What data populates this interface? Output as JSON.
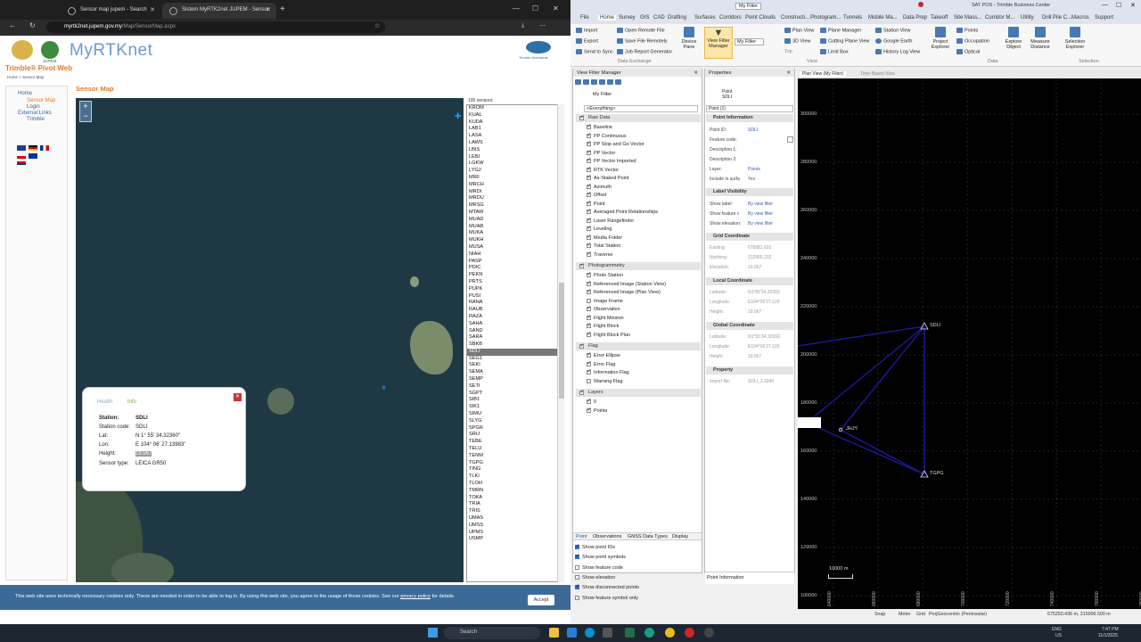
{
  "browser": {
    "tabs": [
      {
        "title": "Sensor map jupem - Search"
      },
      {
        "title": "Sistem MyRTK2net JUPEM - Sensor"
      }
    ],
    "url_host": "myrtk2net.jupem.gov.my",
    "url_path": "/Map/SensorMap.aspx"
  },
  "site": {
    "brand": "MyRTKnet",
    "brand_sub": "JUPEM",
    "subtitle": "Trimble® Pivot Web",
    "corner_logo_text": "Trimble Worldwide",
    "breadcrumb": "Home > Sensor Map",
    "nav": [
      "Home",
      "Sensor Map",
      "Login",
      "External Links",
      "Trimble"
    ],
    "page_title": "Sensor Map",
    "sensor_count": "100 sensors:",
    "sensors": [
      "KROM",
      "KUAL",
      "KUDA",
      "LAB1",
      "LASA",
      "LAWS",
      "LBIS",
      "LEBI",
      "LGKW",
      "LYG2",
      "MIRI",
      "MRCH",
      "MRDI",
      "MRDU",
      "MRSG",
      "MTAW",
      "MUAD",
      "MUAR",
      "MUKA",
      "MUKH",
      "MUSA",
      "NIAH",
      "PASP",
      "PDIC",
      "PEKN",
      "PRTS",
      "PUPK",
      "PUSI",
      "RANA",
      "RAUB",
      "RAZA",
      "SAHA",
      "SAND",
      "SARA",
      "SBKB",
      "SDLI",
      "SEG1",
      "SEKI",
      "SEMA",
      "SEMP",
      "SETI",
      "SGPT",
      "SIB1",
      "SIK1",
      "SIMU",
      "SLYG",
      "SPGR",
      "SRIJ",
      "TEBE",
      "TELU",
      "TENM",
      "TGPG",
      "TING",
      "TLKI",
      "TLOH",
      "TMRN",
      "TOKA",
      "TRIA",
      "TRIS",
      "UMAS",
      "UMSS",
      "UPMS",
      "USMP"
    ],
    "selected_sensor": "SDLI",
    "popup": {
      "tab_health": "Health",
      "tab_info": "Info",
      "rows": [
        {
          "label": "Station:",
          "value": "SDLI"
        },
        {
          "label": "Station code:",
          "value": "SDLI"
        },
        {
          "label": "Lat:",
          "value": "N 1° 55' 34.32360\""
        },
        {
          "label": "Lon:",
          "value": "E 104° 06' 27.13983\""
        },
        {
          "label": "Height:",
          "value": "19.567"
        },
        {
          "label": "Sensor type:",
          "value": "LEICA GR50"
        }
      ]
    },
    "cookie_text": "This web site uses technically necessary cookies only. These are needed in order to be able to log in. By using this web site, you agree to the usage of those cookies. See our",
    "cookie_link": "privacy policy",
    "cookie_tail": "for details.",
    "accept": "Accept"
  },
  "tbc": {
    "title": "SAT POS - Trimble Business Center",
    "filter_name": "My Filter",
    "menus": [
      "File",
      "Home",
      "Survey",
      "GIS",
      "CAD",
      "Drafting",
      "Surfaces",
      "Corridors",
      "Point Clouds",
      "Constructi...",
      "Photogram...",
      "Tunnels",
      "Mobile Ma...",
      "Data Prep",
      "Takeoff",
      "Site Mass...",
      "Corridor M...",
      "Utility",
      "Drill Pile C...",
      "Macros",
      "Support"
    ],
    "ribbon": {
      "import": "Import",
      "export": "Export",
      "send_to_sync": "Send to Sync",
      "open_remote": "Open Remote File",
      "save_remote": "Save File Remotely",
      "job_report": "Job Report Generator",
      "group_data_exchange": "Data Exchange",
      "device_pane": "Device Pane",
      "view_filter_manager": "View Filter Manager",
      "my_filter": "My Filter",
      "plan_view": "Plan View",
      "view_3d": "3D View",
      "top": "Top",
      "plane_manager": "Plane Manager",
      "cutting_plane_view": "Cutting Plane View",
      "limit_box": "Limit Box",
      "station_view": "Station View",
      "google_earth": "Google Earth",
      "history_log_view": "History Log View",
      "group_view": "View",
      "project_explorer": "Project Explorer",
      "points": "Points",
      "occupation": "Occupation",
      "optical": "Optical",
      "explore_object": "Explore Object",
      "measure_distance": "Measure Distance",
      "group_data": "Data",
      "selection_explorer": "Selection Explorer",
      "group_selection": "Selection"
    },
    "vfm": {
      "title": "View Filter Manager",
      "filter": "My Filter",
      "everything": "<Everything>",
      "groups": [
        {
          "name": "Raw Data",
          "items": [
            {
              "label": "Baseline",
              "on": true
            },
            {
              "label": "PP Continuous",
              "on": true
            },
            {
              "label": "PP Stop and Go Vector",
              "on": true
            },
            {
              "label": "PP Vector",
              "on": true
            },
            {
              "label": "PP Vector Imported",
              "on": true
            },
            {
              "label": "RTK Vector",
              "on": true
            },
            {
              "label": "As-Staked Point",
              "on": true
            },
            {
              "label": "Azimuth",
              "on": true
            },
            {
              "label": "Offset",
              "on": true
            },
            {
              "label": "Point",
              "on": true
            },
            {
              "label": "Averaged Point Relationships",
              "on": true
            },
            {
              "label": "Laser Rangefinder",
              "on": true
            },
            {
              "label": "Leveling",
              "on": true
            },
            {
              "label": "Media Folder",
              "on": true
            },
            {
              "label": "Total Station",
              "on": true
            },
            {
              "label": "Traverse",
              "on": true
            }
          ]
        },
        {
          "name": "Photogrammetry",
          "items": [
            {
              "label": "Photo Station",
              "on": true
            },
            {
              "label": "Referenced Image (Station View)",
              "on": true
            },
            {
              "label": "Referenced Image (Plan View)",
              "on": true
            },
            {
              "label": "Image Frame",
              "on": false
            },
            {
              "label": "Observation",
              "on": true
            },
            {
              "label": "Flight Mission",
              "on": true
            },
            {
              "label": "Flight Block",
              "on": true
            },
            {
              "label": "Flight Block Plan",
              "on": true
            }
          ]
        },
        {
          "name": "Flag",
          "items": [
            {
              "label": "Error Ellipse",
              "on": true
            },
            {
              "label": "Error Flag",
              "on": true
            },
            {
              "label": "Information Flag",
              "on": true
            },
            {
              "label": "Warning Flag",
              "on": false
            }
          ]
        },
        {
          "name": "Layers",
          "items": [
            {
              "label": "0",
              "on": true
            },
            {
              "label": "Points",
              "on": true
            }
          ]
        }
      ],
      "bottom_tabs": [
        "Point",
        "Observations",
        "GNSS Data Types",
        "Display"
      ],
      "options": [
        {
          "label": "Show point IDs",
          "on": true
        },
        {
          "label": "Show point symbols",
          "on": true
        },
        {
          "label": "Show feature code",
          "on": false
        },
        {
          "label": "Show elevation",
          "on": false
        },
        {
          "label": "Show disconnected points",
          "on": true
        },
        {
          "label": "Show feature symbol only",
          "on": false
        }
      ]
    },
    "props": {
      "title": "Properties",
      "header_type": "Point",
      "header_id": "SDLI",
      "point_count": "Point (1)",
      "sections": {
        "point_info": "Point Information",
        "label_vis": "Label Visibility",
        "grid": "Grid Coordinate",
        "local": "Local Coordinate",
        "global": "Global Coordinate",
        "property": "Property"
      },
      "point_id_label": "Point ID:",
      "point_id": "SDLI",
      "feature_code_label": "Feature code:",
      "desc1_label": "Description 1:",
      "desc2_label": "Description 2:",
      "layer_label": "Layer:",
      "layer": "Points",
      "include_label": "Include in surfa",
      "include": "Yes",
      "show_label_label": "Show label:",
      "show_label": "By view filter",
      "show_feature_label": "Show feature c",
      "show_feature": "By view filter",
      "show_elev_label": "Show elevation:",
      "show_elev": "By view filter",
      "easting_label": "Easting:",
      "easting": "679981.601",
      "northing_label": "Northing:",
      "northing": "212965.232",
      "elevation_label": "Elevation:",
      "elevation": "19.567",
      "lat_label": "Latitude:",
      "lat": "N1°55'34.32360",
      "lon_label": "Longitude:",
      "lon": "E104°06'27.139",
      "height_label": "Height:",
      "height": "19.567",
      "glat": "N1°55'34.32360",
      "glon": "E104°06'27.139",
      "gheight": "19.567",
      "import_label": "Import file:",
      "import_file": "SDLI_1.3240",
      "footer": "Point Information"
    },
    "planview": {
      "tab_plan": "Plan View (My Filter)",
      "tab_time": "Time-Based View",
      "y_ticks": [
        "300000",
        "280000",
        "260000",
        "240000",
        "220000",
        "200000",
        "180000",
        "160000",
        "140000",
        "120000",
        "100000"
      ],
      "x_ticks": [
        "640000",
        "660000",
        "680000",
        "700000",
        "720000",
        "740000",
        "760000",
        "780000"
      ],
      "points": [
        "SDLI",
        "JHJY",
        "TGPG"
      ],
      "scale": "10000 m",
      "status": [
        "Snap",
        "Meter",
        "Grid",
        "ProjGeocentric (Peninsular)",
        "675250.436 m, 315006.500 m"
      ]
    }
  },
  "taskbar": {
    "search": "Search",
    "lang": "ENG",
    "region": "US",
    "time": "7:47 PM",
    "date": "11/1/2025"
  }
}
